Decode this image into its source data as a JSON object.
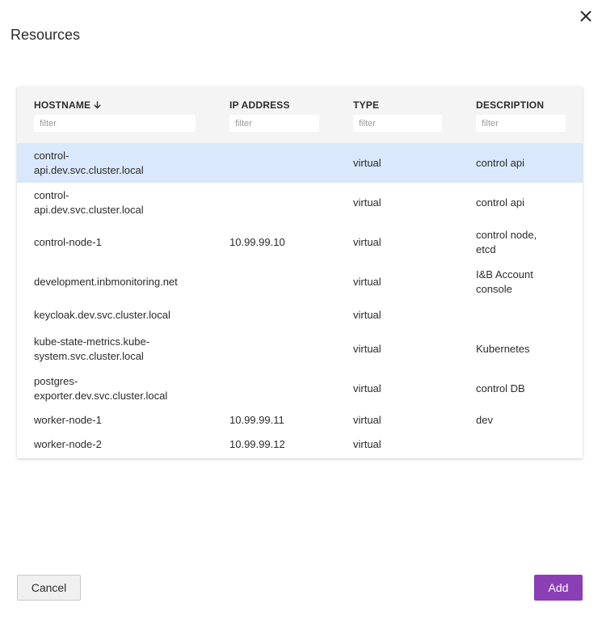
{
  "dialog": {
    "title": "Resources",
    "close_icon": "close-icon"
  },
  "table": {
    "columns": [
      {
        "label": "HOSTNAME",
        "filter_placeholder": "filter",
        "sort": "descending"
      },
      {
        "label": "IP ADDRESS",
        "filter_placeholder": "filter"
      },
      {
        "label": "TYPE",
        "filter_placeholder": "filter"
      },
      {
        "label": "DESCRIPTION",
        "filter_placeholder": "filter"
      }
    ],
    "rows": [
      {
        "hostname": "control-\napi.dev.svc.cluster.local",
        "ip": "",
        "type": "virtual",
        "description": "control api",
        "selected": true
      },
      {
        "hostname": "control-\napi.dev.svc.cluster.local",
        "ip": "",
        "type": "virtual",
        "description": "control api",
        "selected": false
      },
      {
        "hostname": "control-node-1",
        "ip": "10.99.99.10",
        "type": "virtual",
        "description": "control node,\netcd",
        "selected": false
      },
      {
        "hostname": "development.inbmonitoring.net",
        "ip": "",
        "type": "virtual",
        "description": "I&B Account\nconsole",
        "selected": false
      },
      {
        "hostname": "keycloak.dev.svc.cluster.local",
        "ip": "",
        "type": "virtual",
        "description": "",
        "selected": false
      },
      {
        "hostname": "kube-state-metrics.kube-\nsystem.svc.cluster.local",
        "ip": "",
        "type": "virtual",
        "description": "Kubernetes",
        "selected": false
      },
      {
        "hostname": "postgres-\nexporter.dev.svc.cluster.local",
        "ip": "",
        "type": "virtual",
        "description": "control DB",
        "selected": false
      },
      {
        "hostname": "worker-node-1",
        "ip": "10.99.99.11",
        "type": "virtual",
        "description": "dev",
        "selected": false
      },
      {
        "hostname": "worker-node-2",
        "ip": "10.99.99.12",
        "type": "virtual",
        "description": "",
        "selected": false
      }
    ]
  },
  "footer": {
    "cancel_label": "Cancel",
    "add_label": "Add"
  },
  "colors": {
    "accent": "#8a3fb5",
    "selected_row": "#d9e8fa",
    "header_bg": "#f4f4f4"
  }
}
